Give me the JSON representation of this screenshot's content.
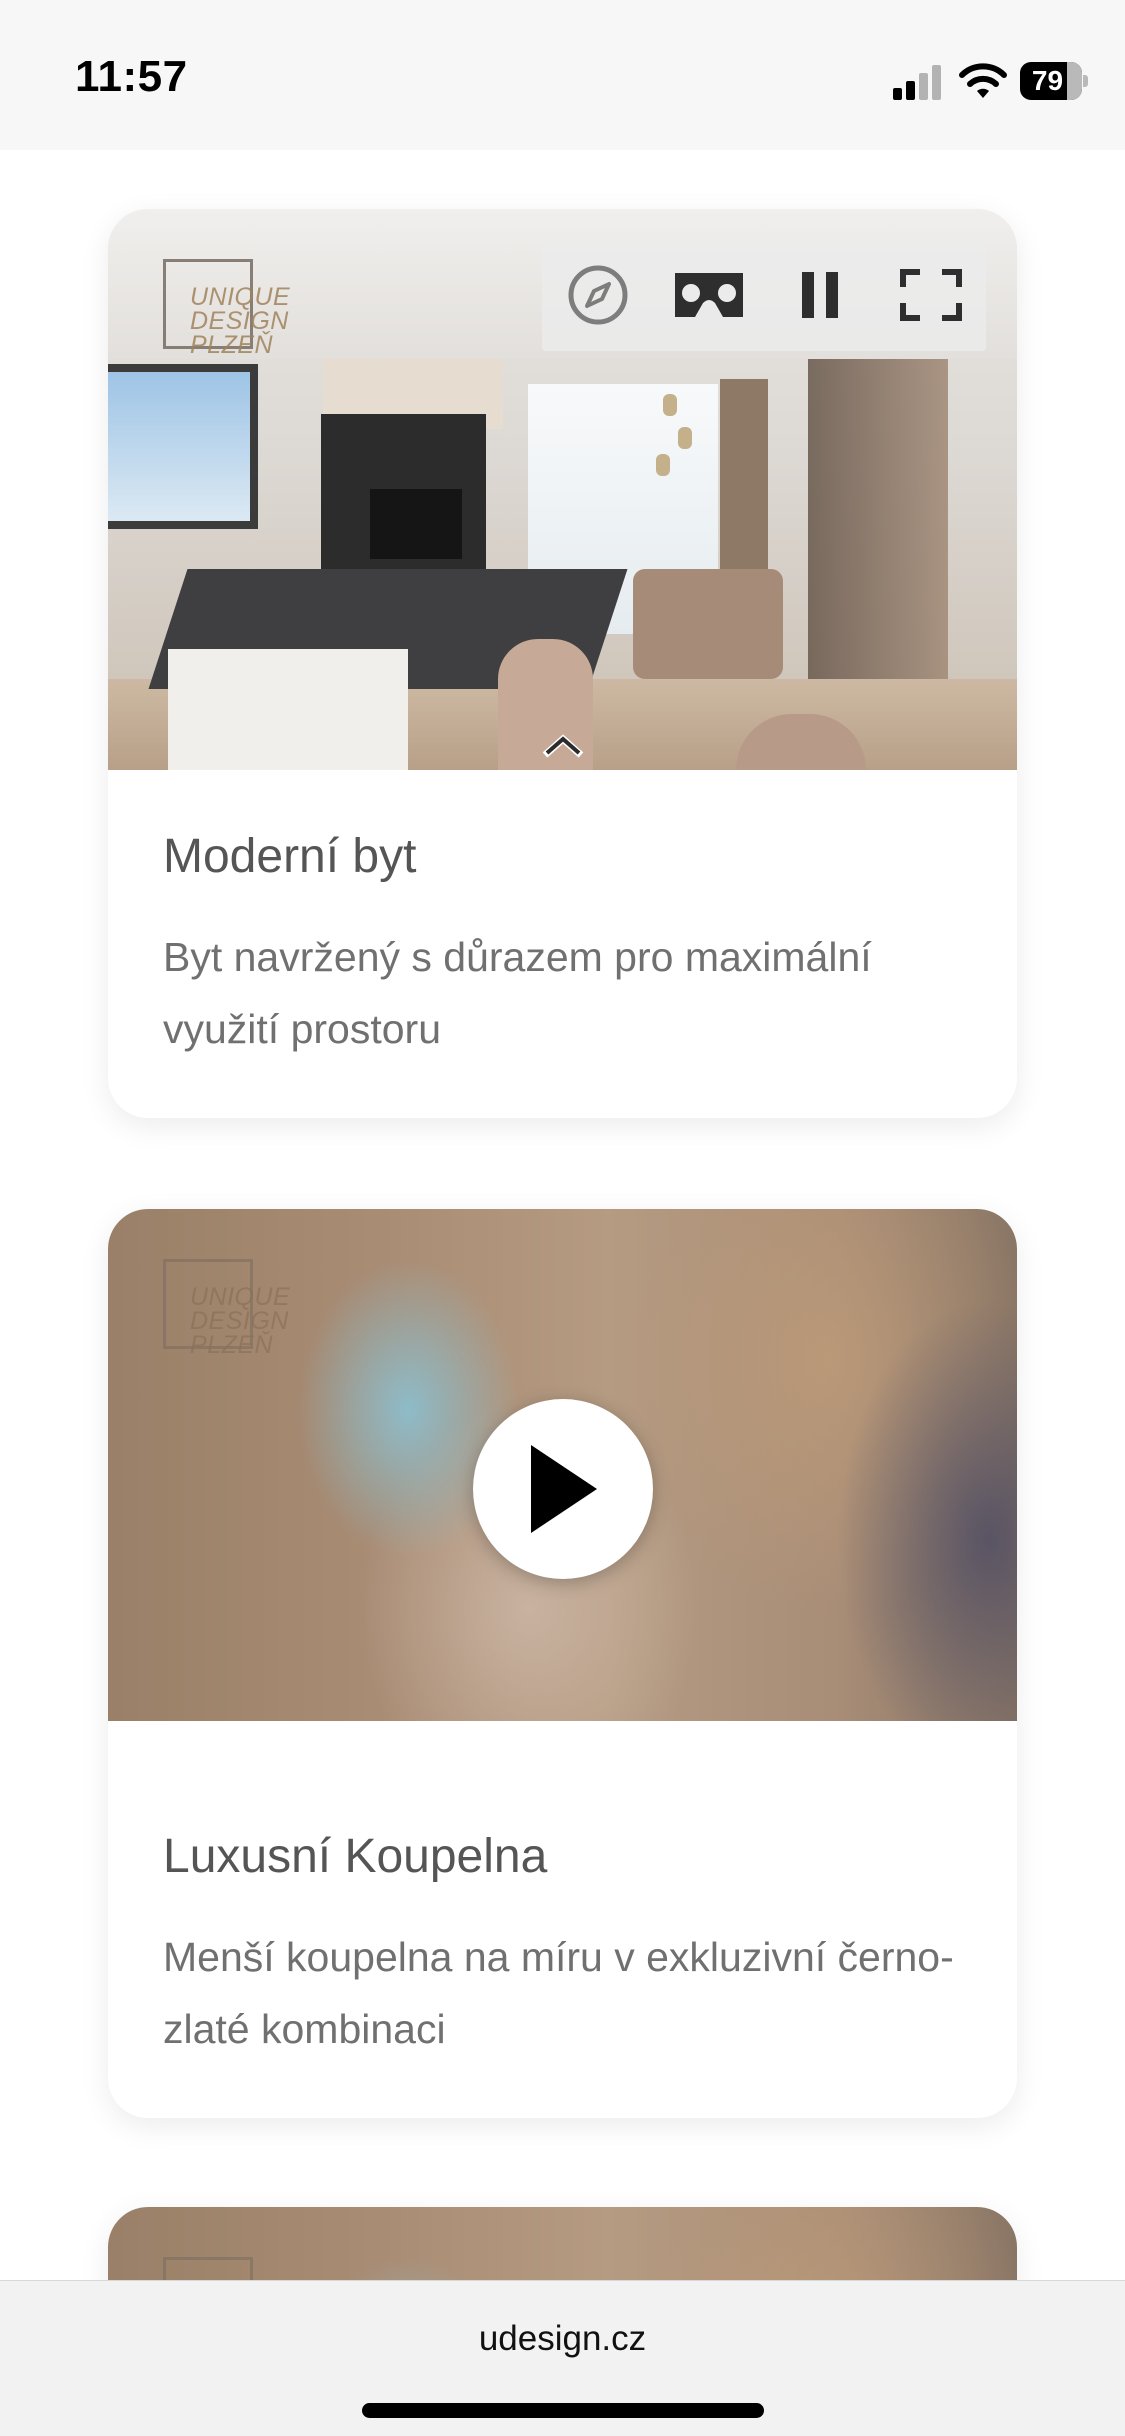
{
  "status_bar": {
    "time": "11:57",
    "battery_percent": "79"
  },
  "cards": [
    {
      "title": "Moderní byt",
      "description": "Byt navržený s důrazem pro maximální využití prostoru",
      "logo_text": "UNIQUE DESIGN PLZEŇ",
      "media_type": "panorama-viewer",
      "controls": [
        "compass-icon",
        "vr-headset-icon",
        "pause-icon",
        "fullscreen-icon"
      ]
    },
    {
      "title": "Luxusní Koupelna",
      "description": "Menší koupelna na míru v exkluzivní černo-zlaté kombinaci",
      "logo_text": "UNIQUE DESIGN PLZEŇ",
      "media_type": "video-preview",
      "controls": [
        "play-icon"
      ]
    }
  ],
  "browser": {
    "url": "udesign.cz"
  }
}
